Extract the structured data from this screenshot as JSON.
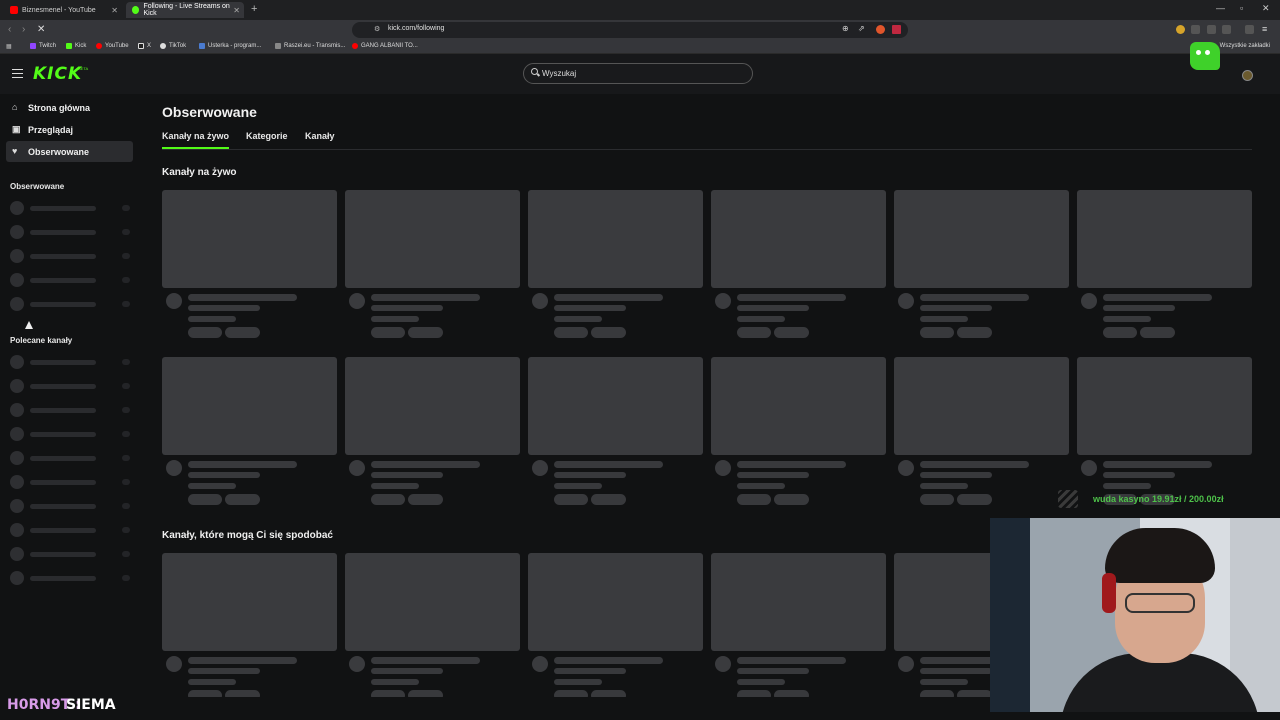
{
  "browser": {
    "tabs": [
      {
        "title": "Biznesmenel - YouTube",
        "color": "#ff0000"
      },
      {
        "title": "Following - Live Streams on Kick",
        "color": "#53fc18"
      }
    ],
    "new_tab": "+",
    "url": "kick.com/following",
    "bookmarks": [
      {
        "label": "Twitch",
        "color": "#9146ff"
      },
      {
        "label": "Kick",
        "color": "#53fc18"
      },
      {
        "label": "YouTube",
        "color": "#ff0000"
      },
      {
        "label": "X",
        "color": "#dddddd"
      },
      {
        "label": "TikTok",
        "color": "#dddddd"
      },
      {
        "label": "Usterka - program...",
        "color": "#4a7bd0"
      },
      {
        "label": "Raszei.eu - Transmis...",
        "color": "#888888"
      },
      {
        "label": "GANG ALBANII TO...",
        "color": "#ff0000"
      }
    ],
    "all_bookmarks": "Wszystkie zakładki"
  },
  "site": {
    "logo": "KICK",
    "beta": "BETA",
    "search_placeholder": "Wyszukaj",
    "accent": "#53fc18"
  },
  "sidebar": {
    "nav": [
      {
        "label": "Strona główna",
        "icon": "home-icon",
        "glyph": "⌂"
      },
      {
        "label": "Przeglądaj",
        "icon": "browse-icon",
        "glyph": "▣"
      },
      {
        "label": "Obserwowane",
        "icon": "heart-icon",
        "glyph": "♥"
      }
    ],
    "following_header": "Obserwowane",
    "recommended_header": "Polecane kanały"
  },
  "main": {
    "title": "Obserwowane",
    "tabs": [
      "Kanały na żywo",
      "Kategorie",
      "Kanały"
    ],
    "live_section": "Kanały na żywo",
    "suggest_section": "Kanały, które mogą Ci się spodobać"
  },
  "overlay": {
    "donation": "wuda kasyno 19.91zł / 200.00zł",
    "chat_user": "H0RN9T",
    "chat_sep": ":",
    "chat_msg": "SIEMA"
  }
}
